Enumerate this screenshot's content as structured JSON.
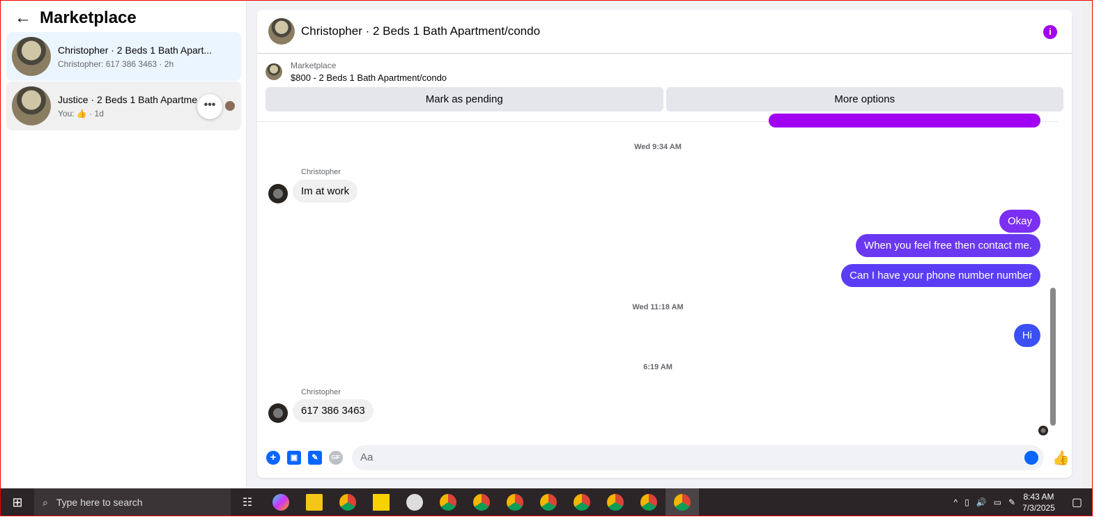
{
  "sidebar": {
    "title": "Marketplace",
    "conversations": [
      {
        "title": "Christopher · 2 Beds 1 Bath Apart...",
        "preview": "Christopher: 617 386 3463 · 2h",
        "selected": true
      },
      {
        "title": "Justice · 2 Beds 1 Bath Apartme",
        "preview": "You: 👍 · 1d",
        "selected": false
      }
    ]
  },
  "chat": {
    "title": "Christopher · 2 Beds 1 Bath Apartment/condo",
    "marketplace_label": "Marketplace",
    "listing": "$800 - 2 Beds 1 Bath Apartment/condo",
    "mark_pending": "Mark as pending",
    "more_options": "More options",
    "messages": {
      "ts1": "Wed 9:34 AM",
      "sender1": "Christopher",
      "m1": "Im at work",
      "o1": "Okay",
      "o2": "When you feel free then contact me.",
      "o3": "Can I have your phone number number",
      "ts2": "Wed 11:18 AM",
      "o4": "Hi",
      "ts3": "6:19 AM",
      "sender2": "Christopher",
      "m2": "617 386 3463"
    },
    "composer_placeholder": "Aa",
    "gif_label": "GIF"
  },
  "colors": {
    "accent": "#0866ff",
    "info": "#a100f2",
    "bubble_top": "#a100f2",
    "bubble_okay": "#7b2ff2",
    "bubble_mid": "#6a38f0",
    "bubble_phone": "#5b3df5",
    "bubble_hi": "#3b4ff5"
  },
  "taskbar": {
    "search_placeholder": "Type here to search",
    "time": "8:43 AM",
    "date": "7/3/2025"
  }
}
